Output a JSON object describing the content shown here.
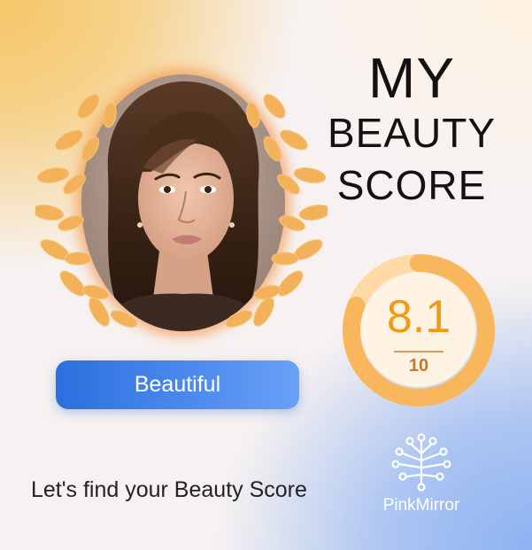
{
  "title": {
    "line1": "MY",
    "line2": "BEAUTY",
    "line3": "SCORE"
  },
  "score": {
    "value": "8.1",
    "max": "10",
    "fraction": 0.81
  },
  "verdict": {
    "label": "Beautiful"
  },
  "tagline": "Let's find your Beauty Score",
  "brand": {
    "name": "PinkMirror",
    "icon": "tree-circuit-icon"
  },
  "portrait": {
    "icon": "portrait-photo",
    "laurel_icon": "laurel-wreath-icon"
  },
  "colors": {
    "accent_orange": "#f29a12",
    "laurel_gold": "#f3b25a",
    "button_blue": "#3b7ae6",
    "background_top_left": "#f6c768",
    "background_bottom_right": "#8db2f2"
  }
}
